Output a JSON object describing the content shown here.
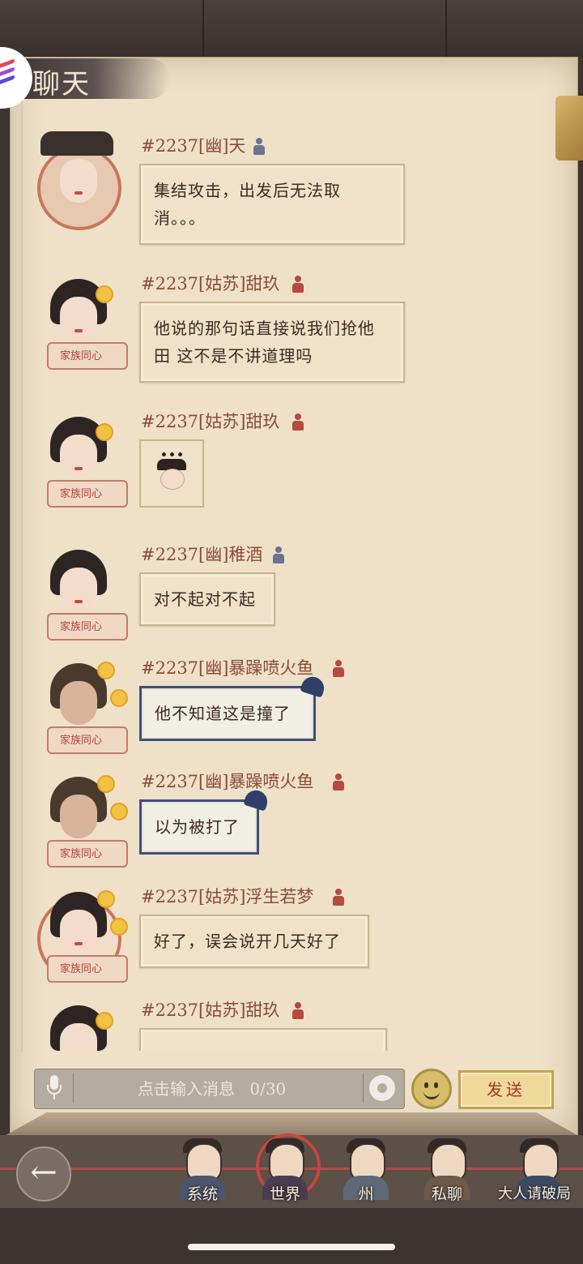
{
  "header": {
    "title": "聊天"
  },
  "messages": [
    {
      "name": "#2237[幽]天",
      "text": "集结攻击，出发后无法取消。。。",
      "style": "normal",
      "badge": ""
    },
    {
      "name": "#2237[姑苏]甜玖",
      "text": "他说的那句话直接说我们抢他田 这不是不讲道理吗",
      "style": "normal",
      "badge": "家族同心"
    },
    {
      "name": "#2237[姑苏]甜玖",
      "text": "",
      "style": "sticker",
      "badge": "家族同心"
    },
    {
      "name": "#2237[幽]稚酒",
      "text": "对不起对不起",
      "style": "normal",
      "badge": "家族同心"
    },
    {
      "name": "#2237[幽]暴躁喷火鱼",
      "text": "他不知道这是撞了",
      "style": "blue",
      "badge": "家族同心"
    },
    {
      "name": "#2237[幽]暴躁喷火鱼",
      "text": "以为被打了",
      "style": "blue",
      "badge": "家族同心"
    },
    {
      "name": "#2237[姑苏]浮生若梦",
      "text": "好了，误会说开几天好了",
      "style": "normal",
      "badge": "家族同心"
    },
    {
      "name": "#2237[姑苏]甜玖",
      "text": "",
      "style": "normal",
      "badge": ""
    }
  ],
  "input": {
    "placeholder": "点击输入消息",
    "counter": "0/30"
  },
  "send": {
    "label": "发送"
  },
  "nav": {
    "tabs": [
      {
        "label": "系统"
      },
      {
        "label": "世界"
      },
      {
        "label": "州"
      },
      {
        "label": "私聊"
      },
      {
        "label": "大人请破局"
      }
    ]
  },
  "colors": {
    "paper": "#eee1c8",
    "name_text": "#8b4b3a",
    "blue_border": "#3f4f7a",
    "send_text": "#a2352c"
  }
}
